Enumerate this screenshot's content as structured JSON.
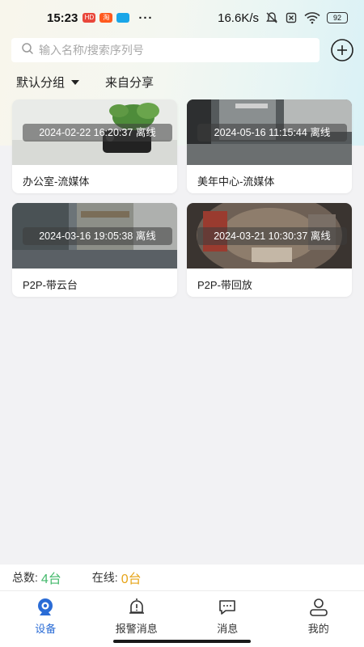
{
  "status_bar": {
    "time": "15:23",
    "speed": "16.6K/s",
    "battery": "92",
    "app_icons": [
      "hd-icon",
      "taobao-icon",
      "app-icon"
    ]
  },
  "search": {
    "placeholder": "输入名称/搜索序列号"
  },
  "groups": {
    "default_group": "默认分组",
    "shared": "来自分享"
  },
  "devices": [
    {
      "name": "办公室-流媒体",
      "timestamp": "2024-02-22 16:20:37",
      "status": "离线"
    },
    {
      "name": "美年中心-流媒体",
      "timestamp": "2024-05-16 11:15:44",
      "status": "离线"
    },
    {
      "name": "P2P-带云台",
      "timestamp": "2024-03-16 19:05:38",
      "status": "离线"
    },
    {
      "name": "P2P-带回放",
      "timestamp": "2024-03-21 10:30:37",
      "status": "离线"
    }
  ],
  "summary": {
    "total_label": "总数:",
    "total_value": "4台",
    "online_label": "在线:",
    "online_value": "0台"
  },
  "tabs": [
    {
      "label": "设备",
      "icon": "camera-icon",
      "active": true
    },
    {
      "label": "报警消息",
      "icon": "alarm-bell-icon",
      "active": false
    },
    {
      "label": "消息",
      "icon": "message-icon",
      "active": false
    },
    {
      "label": "我的",
      "icon": "user-icon",
      "active": false
    }
  ],
  "colors": {
    "accent": "#2a6cd6",
    "total_count": "#43b96b",
    "online_count": "#e6a418"
  }
}
